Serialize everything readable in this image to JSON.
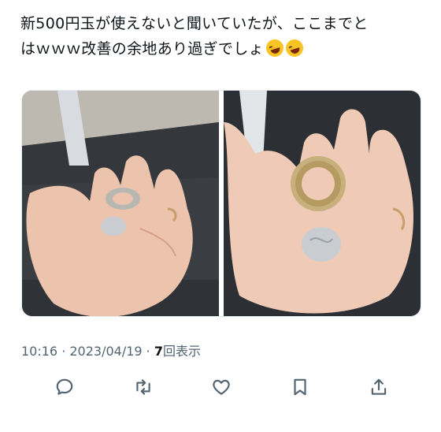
{
  "tweet": {
    "text_line1": "新500円玉が使えないと聞いていたが、ここまでと",
    "text_line2": "はｗｗｗ改善の余地あり過ぎでしょ",
    "emoji": "rolling-on-floor-laughing-emoji"
  },
  "meta": {
    "time": "10:16",
    "separator": " · ",
    "date": "2023/04/19",
    "views_count": "7",
    "views_label": "回表示"
  },
  "actions": [
    {
      "icon": "reply-icon"
    },
    {
      "icon": "retweet-icon"
    },
    {
      "icon": "like-icon"
    },
    {
      "icon": "bookmark-icon"
    },
    {
      "icon": "share-icon"
    }
  ],
  "colors": {
    "text": "#0f1419",
    "secondary": "#536471",
    "icon": "#536471"
  }
}
